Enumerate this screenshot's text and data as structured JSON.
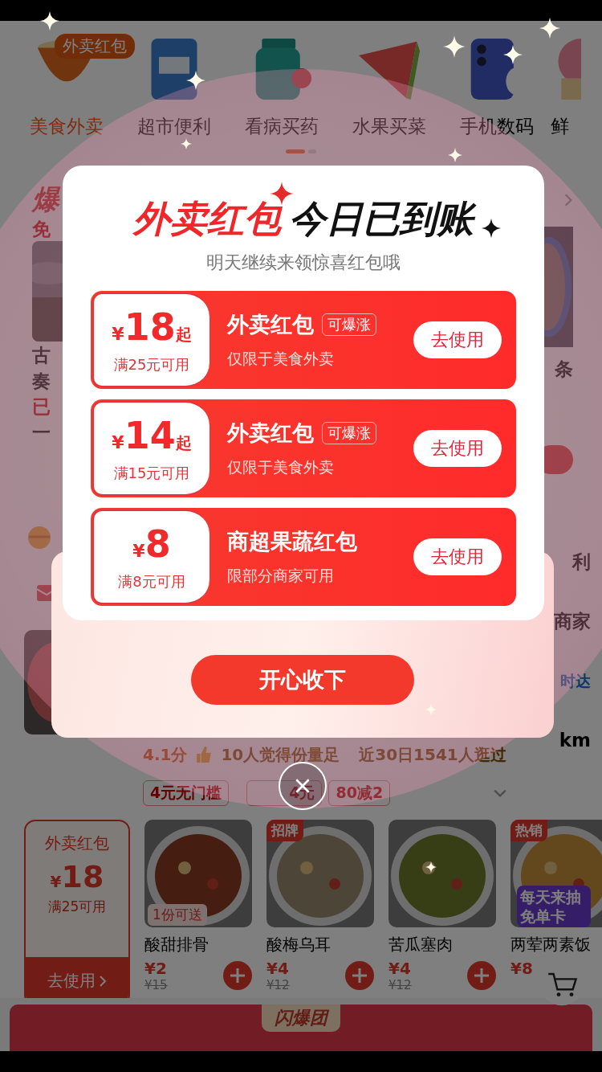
{
  "categories": [
    {
      "label": "美食外卖",
      "kind": "bowl",
      "selected": true,
      "badge": "外卖红包"
    },
    {
      "label": "超市便利",
      "kind": "bag",
      "selected": false
    },
    {
      "label": "看病买药",
      "kind": "medicine",
      "selected": false
    },
    {
      "label": "水果买菜",
      "kind": "watermelon",
      "selected": false
    },
    {
      "label": "手机数码",
      "kind": "phone",
      "selected": false
    },
    {
      "label": "鲜",
      "kind": "flower",
      "selected": false
    }
  ],
  "store": {
    "logo": "爆",
    "left_fragments": [
      "免",
      "古",
      "奏",
      "已",
      "一"
    ],
    "right_fragments": [
      "条",
      "利",
      "商家",
      "时达",
      "km"
    ]
  },
  "rating": {
    "score": "4.1分",
    "praise": "10人觉得份量足",
    "visits": "近30日1541人逛过"
  },
  "tags": [
    "4元无门槛",
    "4元",
    "80减2"
  ],
  "side_coupon": {
    "title": "外卖红包",
    "currency": "¥",
    "amount": "18",
    "condition": "满25可用",
    "action": "去使用"
  },
  "products": [
    {
      "name": "酸甜排骨",
      "price": "¥2",
      "original": "¥15",
      "badge": {
        "text": "1份可送",
        "kind": "bottom"
      }
    },
    {
      "name": "酸梅乌耳",
      "price": "¥4",
      "original": "¥12",
      "badge": {
        "text": "招牌",
        "kind": "top"
      }
    },
    {
      "name": "苦瓜塞肉",
      "price": "¥4",
      "original": "¥12"
    },
    {
      "name": "两荤两素饭",
      "price": "¥8",
      "badge": {
        "text": "热销",
        "kind": "top"
      },
      "promo": "每天来抽免单卡"
    }
  ],
  "banner": {
    "tab": "闪爆团"
  },
  "popup": {
    "title_red": "外卖红包",
    "title_black": "今日已到账",
    "subtitle": "明天继续来领惊喜红包哦",
    "coupons": [
      {
        "currency": "¥",
        "amount": "18",
        "suffix": "起",
        "condition": "满25元可用",
        "title": "外卖红包",
        "tag": "可爆涨",
        "note": "仅限于美食外卖",
        "button": "去使用"
      },
      {
        "currency": "¥",
        "amount": "14",
        "suffix": "起",
        "condition": "满15元可用",
        "title": "外卖红包",
        "tag": "可爆涨",
        "note": "仅限于美食外卖",
        "button": "去使用"
      },
      {
        "currency": "¥",
        "amount": "8",
        "condition": "满8元可用",
        "title": "商超果蔬红包",
        "note": "限部分商家可用",
        "button": "去使用"
      }
    ],
    "accept": "开心收下"
  }
}
